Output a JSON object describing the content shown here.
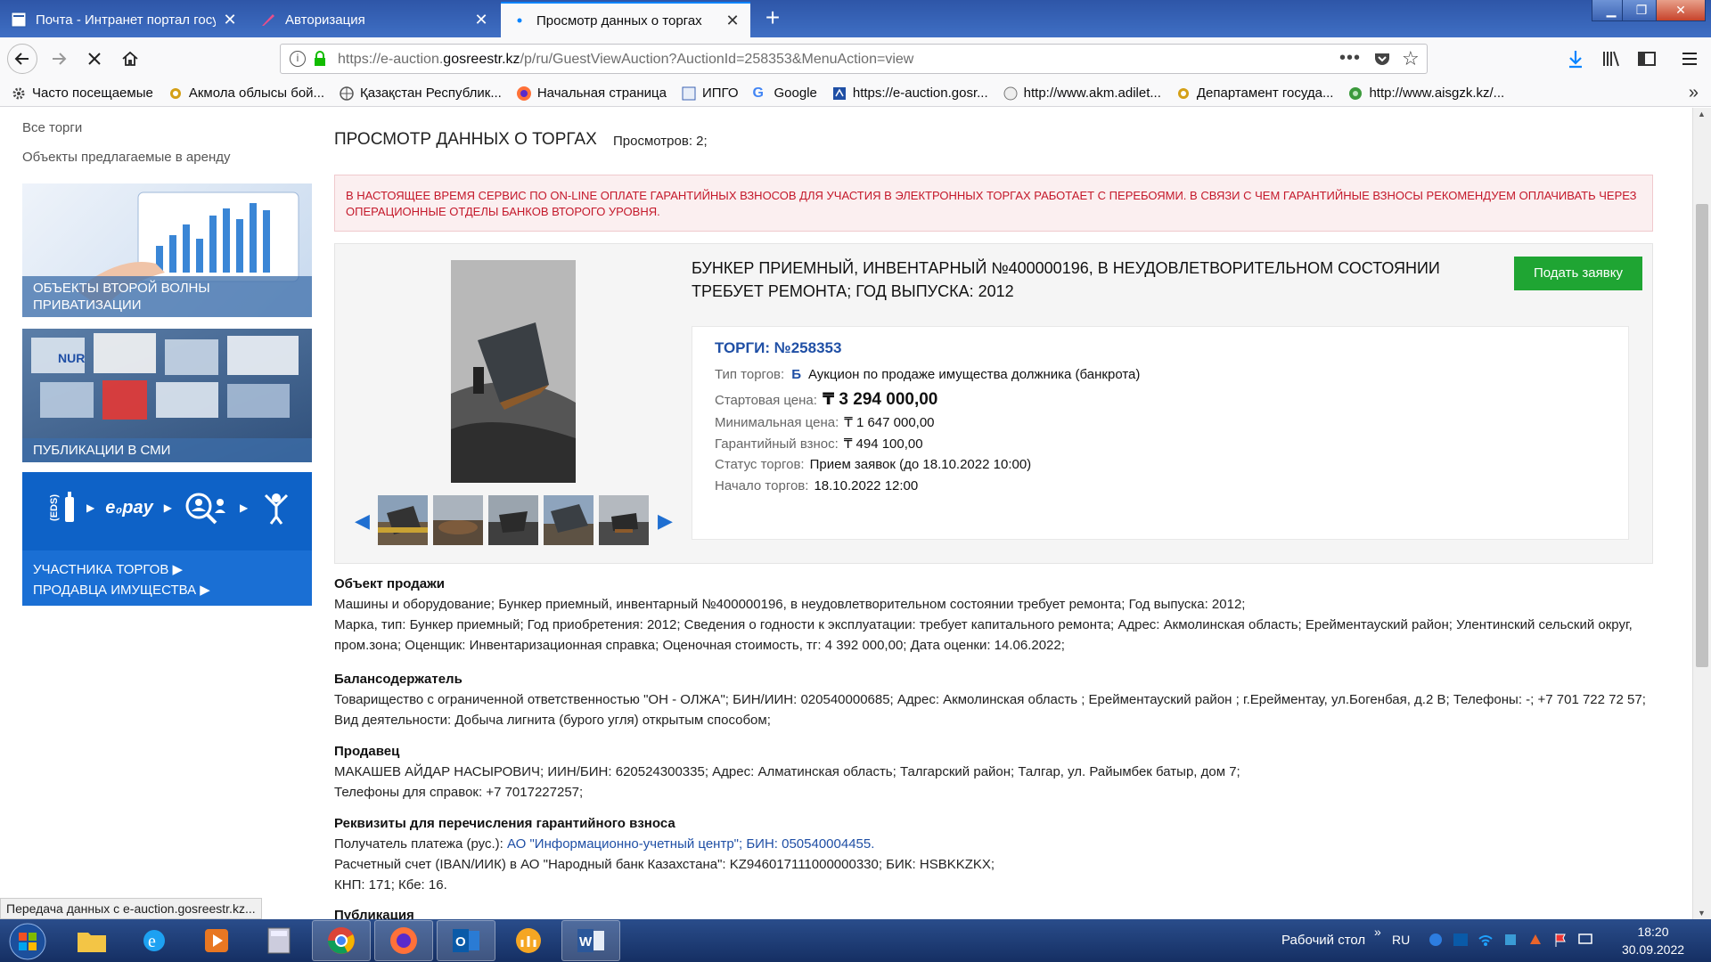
{
  "browser": {
    "tabs": [
      {
        "title": "Почта - Интранет портал госу",
        "active": false
      },
      {
        "title": "Авторизация",
        "active": false
      },
      {
        "title": "Просмотр данных о торгах",
        "active": true
      }
    ],
    "url_prefix": "https://e-auction.",
    "url_host": "gosreestr.kz",
    "url_path": "/p/ru/GuestViewAuction?AuctionId=258353&MenuAction=view",
    "bookmarks": [
      {
        "label": "Часто посещаемые",
        "icon": "gear-icon"
      },
      {
        "label": "Акмола облысы бой...",
        "icon": "gear-icon"
      },
      {
        "label": "Қазақстан Республик...",
        "icon": "globe-icon"
      },
      {
        "label": "Начальная страница",
        "icon": "firefox-icon"
      },
      {
        "label": "ИПГО",
        "icon": "page-icon"
      },
      {
        "label": "Google",
        "icon": "google-icon"
      },
      {
        "label": "https://e-auction.gosr...",
        "icon": "page-icon"
      },
      {
        "label": "http://www.akm.adilet...",
        "icon": "globe-icon"
      },
      {
        "label": "Департамент госуда...",
        "icon": "gear-icon"
      },
      {
        "label": "http://www.aisgzk.kz/...",
        "icon": "globe-icon"
      }
    ]
  },
  "sidebar": {
    "links": [
      "Все торги",
      "Объекты предлагаемые в аренду"
    ],
    "banners": {
      "privatization": "Объекты второй волны приватизации",
      "media": "Публикации в СМИ",
      "participant": "Участника торгов ▶",
      "seller": "Продавца имущества ▶",
      "epay": "e₀pay",
      "eds": "(EDS)"
    }
  },
  "page": {
    "title": "ПРОСМОТР ДАННЫХ О ТОРГАХ",
    "views": "Просмотров: 2;",
    "alert": "В настоящее время сервис по on-line оплате гарантийных взносов для участия в электронных торгах работает с перебоями. В связи с чем гарантийные взносы рекомендуем оплачивать через операционные отделы банков второго уровня."
  },
  "lot": {
    "title": "Бункер приемный, инвентарный №400000196, в неудовлетворительном состоянии требует ремонта; Год выпуска: 2012",
    "apply_button": "Подать заявку",
    "torgi": "ТОРГИ: №258353",
    "type_label": "Тип торгов:",
    "type_badge": "Б",
    "type_value": "Аукцион по продаже имущества должника (банкрота)",
    "start_price_label": "Стартовая цена:",
    "start_price": "₸ 3 294 000,00",
    "min_price_label": "Минимальная цена:",
    "min_price": "₸ 1 647 000,00",
    "guarantee_label": "Гарантийный взнос:",
    "guarantee": "₸ 494 100,00",
    "status_label": "Статус торгов:",
    "status": "Прием заявок (до 18.10.2022 10:00)",
    "start_label": "Начало торгов:",
    "start": "18.10.2022 12:00"
  },
  "sections": {
    "object_heading": "Объект продажи",
    "object_line1": "Машины и оборудование; Бункер приемный, инвентарный №400000196, в неудовлетворительном состоянии требует ремонта; Год выпуска: 2012;",
    "object_line2": "Марка, тип: Бункер приемный; Год приобретения: 2012; Сведения о годности к эксплуатации: требует капитального ремонта; Адрес: Акмолинская область; Ерейментауский район; Улентинский сельский округ, пром.зона; Оценщик: Инвентаризационная справка; Оценочная стоимость, тг: 4 392 000,00; Дата оценки: 14.06.2022;",
    "holder_heading": "Балансодержатель",
    "holder_text": "Товарищество с ограниченной ответственностью \"ОН - ОЛЖА\"; БИН/ИИН: 020540000685; Адрес: Акмолинская область ; Ерейментауский район ; г.Ерейментау, ул.Богенбая, д.2 В; Телефоны: -; +7 701 722 72 57; Вид деятельности: Добыча лигнита (бурого угля) открытым способом;",
    "seller_heading": "Продавец",
    "seller_line1": "МАКАШЕВ АЙДАР НАСЫРОВИЧ; ИИН/БИН: 620524300335;  Адрес: Алматинская область; Талгарский район; Талгар, ул. Райымбек батыр, дом 7;",
    "seller_line2": "Телефоны для справок: +7 7017227257;",
    "req_heading": "Реквизиты для перечисления гарантийного взноса",
    "req_label": "Получатель платежа (рус.): ",
    "req_link": "АО \"Информационно-учетный центр\"; БИН: 050540004455.",
    "req_line2": "Расчетный счет (IBAN/ИИК) в АО \"Народный банк Казахстана\": KZ946017111000000330; БИК: HSBKKZKX;",
    "req_line3": "КНП: 171; Кбе: 16.",
    "pub_heading": "Публикация"
  },
  "status_bar": "Передача данных с e-auction.gosreestr.kz...",
  "taskbar": {
    "desktop": "Рабочий стол",
    "lang": "RU",
    "time": "18:20",
    "date": "30.09.2022"
  }
}
